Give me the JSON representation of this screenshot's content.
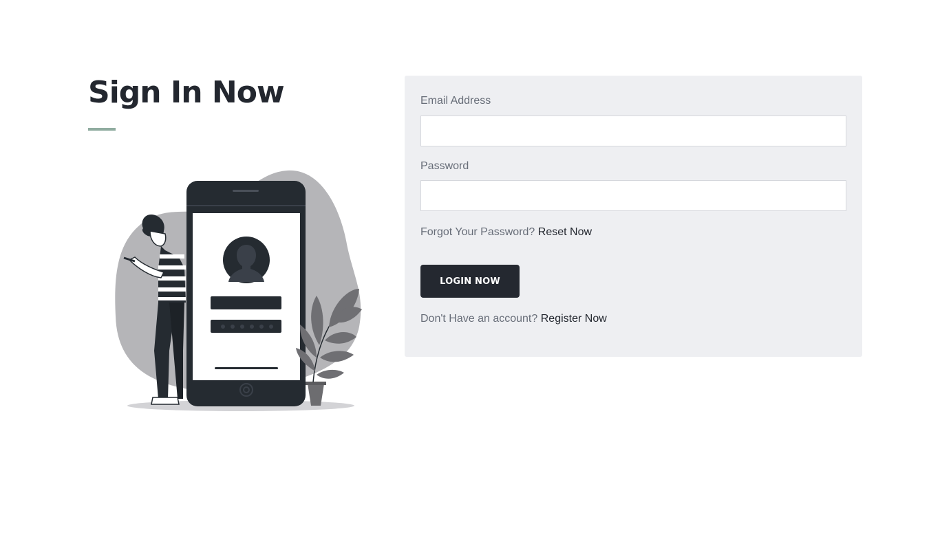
{
  "page": {
    "title": "Sign In Now",
    "accent_color": "#90aca0"
  },
  "illustration": {
    "description_icon": "person-using-phone-login-illustration"
  },
  "form": {
    "email_label": "Email Address",
    "email_value": "",
    "password_label": "Password",
    "password_value": "",
    "forgot_text": "Forgot Your Password?",
    "reset_link": "Reset Now",
    "login_button": "LOGIN NOW",
    "register_text": "Don't Have an account?",
    "register_link": "Register Now"
  },
  "colors": {
    "panel_bg": "#eeeff2",
    "button_bg": "#242830",
    "heading": "#23272f"
  }
}
